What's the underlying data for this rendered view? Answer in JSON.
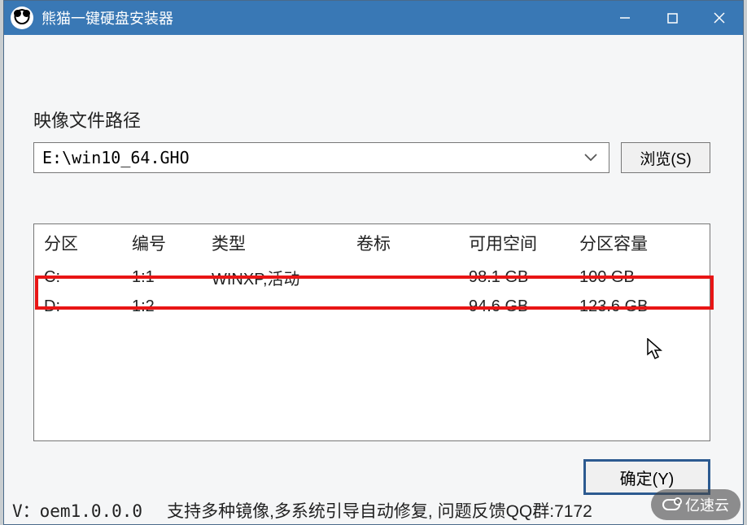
{
  "window": {
    "title": "熊猫一键硬盘安装器"
  },
  "image": {
    "label": "映像文件路径",
    "path": "E:\\win10_64.GHO",
    "browse_label": "浏览(S)"
  },
  "table": {
    "headers": {
      "partition": "分区",
      "number": "编号",
      "type": "类型",
      "label": "卷标",
      "free": "可用空间",
      "capacity": "分区容量"
    },
    "rows": [
      {
        "partition": "C:",
        "number": "1:1",
        "type": "WINXP,活动",
        "label": "",
        "free": "98.1 GB",
        "capacity": "100 GB",
        "highlighted": true
      },
      {
        "partition": "D:",
        "number": "1:2",
        "type": "",
        "label": "",
        "free": "94.6 GB",
        "capacity": "123.6 GB",
        "highlighted": false
      }
    ]
  },
  "buttons": {
    "ok": "确定(Y)"
  },
  "footer": {
    "version": "V：oem1.0.0.0",
    "info": "支持多种镜像,多系统引导自动修复, 问题反馈QQ群:7172"
  },
  "watermark": {
    "text": "亿速云"
  }
}
